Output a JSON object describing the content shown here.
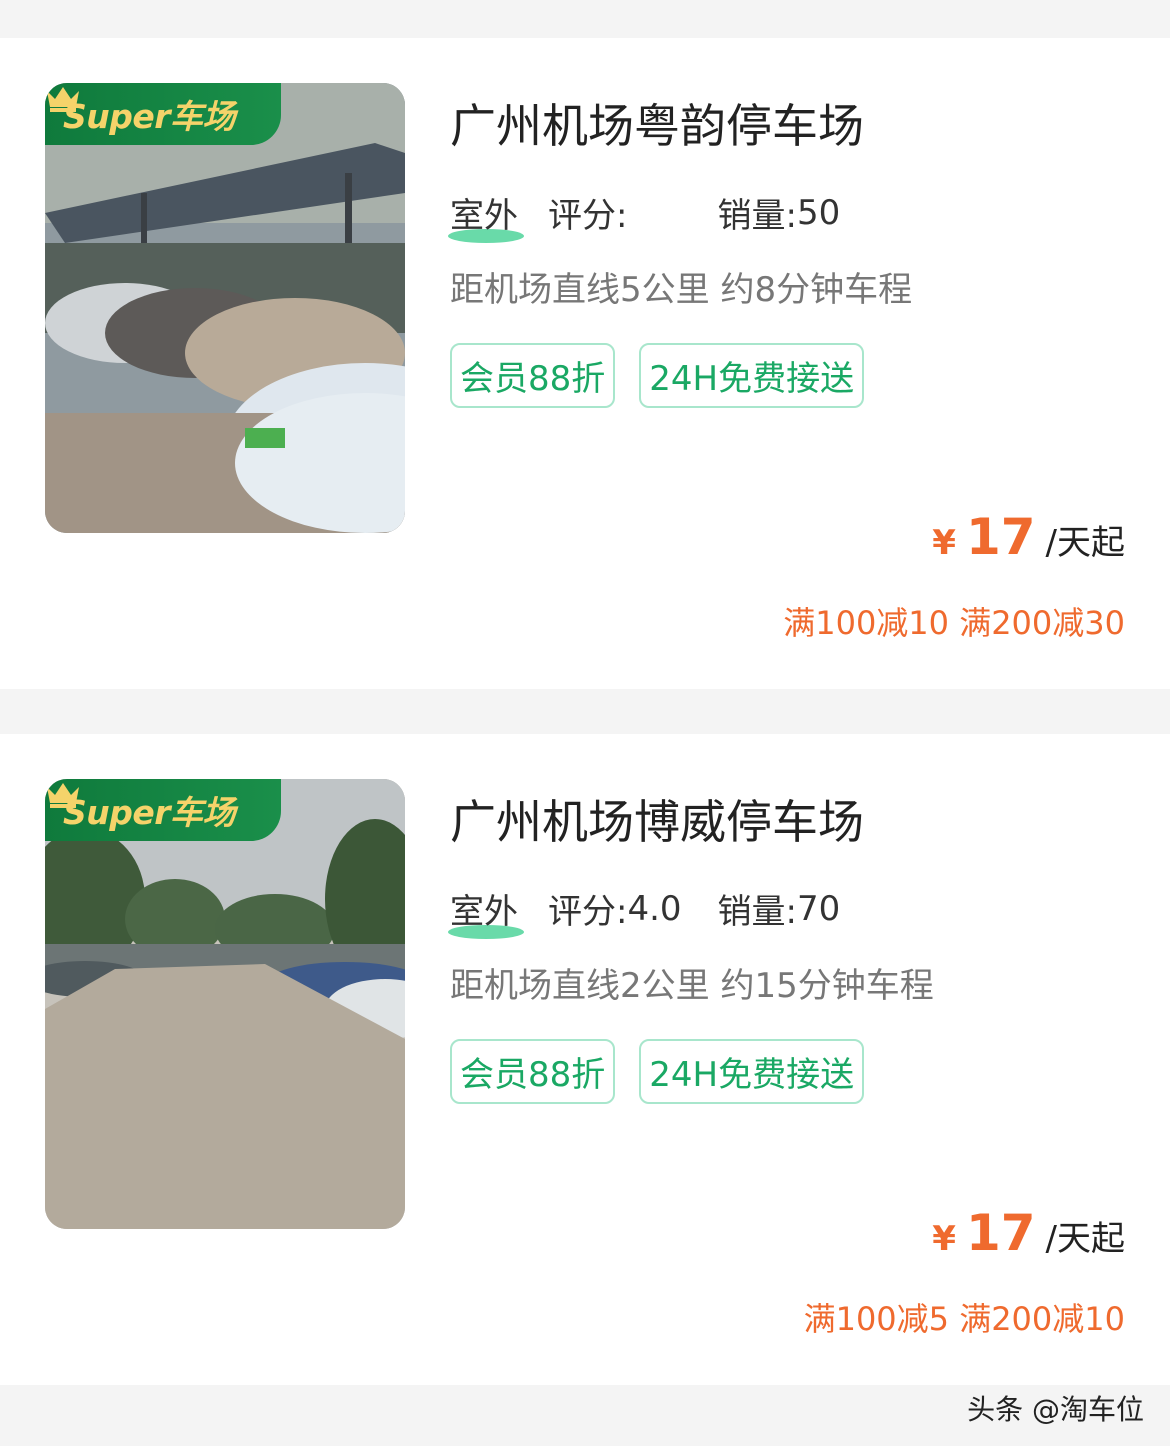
{
  "badge_text": "Super车场",
  "listings": [
    {
      "title": "广州机场粤韵停车场",
      "type": "室外",
      "rating_label": "评分:",
      "rating_value": "",
      "sales_label": "销量:",
      "sales_value": "50",
      "distance": "距机场直线5公里 约8分钟车程",
      "features": [
        "会员88折",
        "24H免费接送"
      ],
      "price_symbol": "¥",
      "price": "17",
      "price_unit": "/天起",
      "discount": "满100减10 满200减30"
    },
    {
      "title": "广州机场博威停车场",
      "type": "室外",
      "rating_label": "评分:",
      "rating_value": "4.0",
      "sales_label": "销量:",
      "sales_value": "70",
      "distance": "距机场直线2公里 约15分钟车程",
      "features": [
        "会员88折",
        "24H免费接送"
      ],
      "price_symbol": "¥",
      "price": "17",
      "price_unit": "/天起",
      "discount": "满100减5 满200减10"
    }
  ],
  "watermark": "头条 @淘车位",
  "colors": {
    "accent_orange": "#ef6a2e",
    "feature_green": "#1aa864",
    "badge_green": "#0f7a3c",
    "badge_gold": "#f5d36a"
  }
}
